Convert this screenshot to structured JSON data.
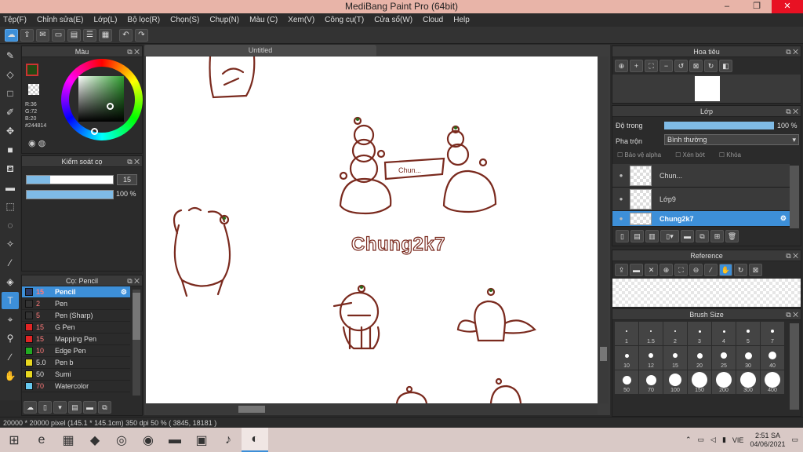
{
  "window": {
    "title": "MediBang Paint Pro (64bit)",
    "min": "–",
    "max": "❐",
    "close": "✕"
  },
  "menu": [
    "Tệp(F)",
    "Chỉnh sửa(E)",
    "Lớp(L)",
    "Bộ lọc(R)",
    "Chọn(S)",
    "Chụp(N)",
    "Màu (C)",
    "Xem(V)",
    "Công cụ(T)",
    "Cửa sổ(W)",
    "Cloud",
    "Help"
  ],
  "color_panel": {
    "title": "Màu",
    "r": "R:36",
    "g": "G:72",
    "b": "B:20",
    "hex": "#244814",
    "fg": "#244814",
    "bg": "#ffffff"
  },
  "control_panel": {
    "title": "Kiểm soát cọ",
    "size_value": "15",
    "opacity_value": "100 %",
    "size_fraction": 0.27,
    "opacity_fraction": 1.0
  },
  "brush_panel": {
    "title": "Cọ: Pencil",
    "items": [
      {
        "size": "15",
        "name": "Pencil",
        "color": "#2a3a66",
        "selected": true
      },
      {
        "size": "2",
        "name": "Pen",
        "color": "#333333"
      },
      {
        "size": "5",
        "name": "Pen (Sharp)",
        "color": "#333333"
      },
      {
        "size": "15",
        "name": "G Pen",
        "color": "#e02424"
      },
      {
        "size": "15",
        "name": "Mapping Pen",
        "color": "#e02424"
      },
      {
        "size": "10",
        "name": "Edge Pen",
        "color": "#22aa22"
      },
      {
        "size": "5.0",
        "name": "Pen b",
        "color": "#e8d820",
        "white": true
      },
      {
        "size": "50",
        "name": "Sumi",
        "color": "#e8d820",
        "white": true
      },
      {
        "size": "70",
        "name": "Watercolor",
        "color": "#66c8ee"
      }
    ]
  },
  "document": {
    "tab": "Untitled",
    "canvas_text": "Chung2k7",
    "banner_text": "Chun..."
  },
  "navigator": {
    "title": "Hoa tiêu"
  },
  "layer_panel": {
    "title": "Lớp",
    "opacity_label": "Độ trong",
    "opacity_value": "100 %",
    "opacity_fraction": 1.0,
    "blend_label": "Pha trộn",
    "blend_value": "Bình thường",
    "protect_alpha": "Bảo vệ alpha",
    "clipping": "Xén bớt",
    "lock": "Khóa",
    "layers": [
      {
        "name": "Chun...",
        "selected": false
      },
      {
        "name": "Lớp9",
        "selected": false
      },
      {
        "name": "Chung2k7",
        "selected": true
      }
    ]
  },
  "reference_panel": {
    "title": "Reference"
  },
  "brushsize_panel": {
    "title": "Brush Size",
    "sizes": [
      "1",
      "1.5",
      "2",
      "3",
      "4",
      "5",
      "7",
      "10",
      "12",
      "15",
      "20",
      "25",
      "30",
      "40",
      "50",
      "70",
      "100",
      "150",
      "200",
      "300",
      "400"
    ]
  },
  "status": {
    "text": "20000 * 20000 pixel  (145.1 * 145.1cm)  350 dpi  50 %  ( 3845, 18181 )"
  },
  "taskbar": {
    "lang": "VIE",
    "time": "2:51 SA",
    "date": "04/06/2021"
  }
}
